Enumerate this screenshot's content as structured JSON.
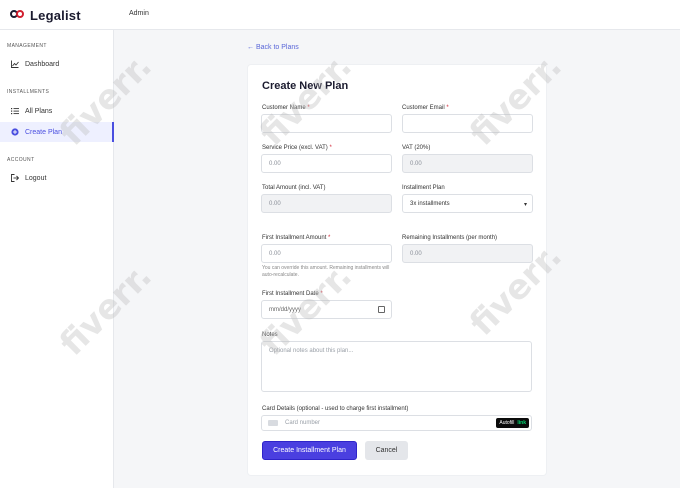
{
  "app": {
    "logo_text": "Legalist",
    "user_label": "Admin"
  },
  "sidebar": {
    "sections": [
      {
        "heading": "MANAGEMENT",
        "items": [
          {
            "label": "Dashboard",
            "icon": "chart-icon"
          }
        ]
      },
      {
        "heading": "INSTALLMENTS",
        "items": [
          {
            "label": "All Plans",
            "icon": "list-icon"
          },
          {
            "label": "Create Plan",
            "icon": "plus-circle-icon",
            "active": true
          }
        ]
      },
      {
        "heading": "ACCOUNT",
        "items": [
          {
            "label": "Logout",
            "icon": "logout-icon"
          }
        ]
      }
    ]
  },
  "page": {
    "back_link": "← Back to Plans",
    "title": "Create New Plan"
  },
  "form": {
    "customer_name_label": "Customer Name",
    "customer_email_label": "Customer Email",
    "service_price_label": "Service Price (excl. VAT)",
    "service_price_placeholder": "0.00",
    "vat_label": "VAT (20%)",
    "vat_value": "0.00",
    "total_label": "Total Amount (incl. VAT)",
    "total_value": "0.00",
    "plan_label": "Installment Plan",
    "plan_selected": "3x installments",
    "first_amount_label": "First Installment Amount",
    "first_amount_placeholder": "0.00",
    "first_amount_hint": "You can override this amount. Remaining installments will auto-recalculate.",
    "remaining_label": "Remaining Installments (per month)",
    "remaining_value": "0.00",
    "first_date_label": "First Installment Date",
    "first_date_placeholder": "mm/dd/yyyy",
    "notes_label": "Notes",
    "notes_placeholder": "Optional notes about this plan...",
    "card_label": "Card Details (optional - used to charge first installment)",
    "card_placeholder": "Card number",
    "autofill_label": "Autofill",
    "autofill_brand": "link",
    "required_mark": "*"
  },
  "actions": {
    "submit_label": "Create Installment Plan",
    "cancel_label": "Cancel"
  },
  "watermark": {
    "text": "fiverr."
  },
  "colors": {
    "accent": "#4a3fe0",
    "required": "#d11f2f"
  }
}
